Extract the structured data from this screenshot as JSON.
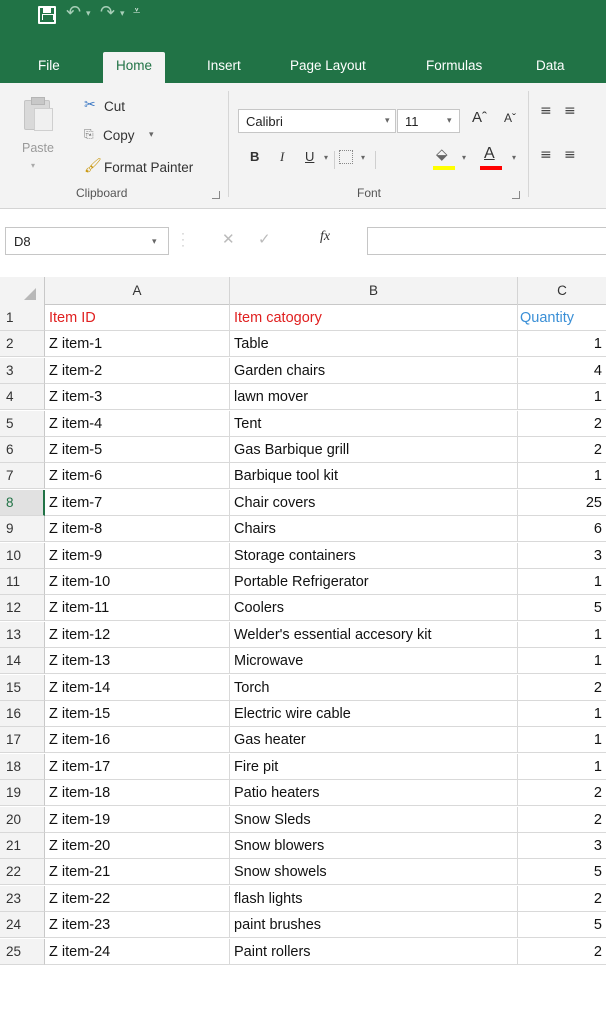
{
  "quick_access": {
    "save_icon": "save-icon",
    "undo_icon": "undo-icon",
    "redo_icon": "redo-icon",
    "customize_icon": "customize-icon",
    "undo_glyph": "↶",
    "redo_glyph": "↷",
    "dd_glyph": "▾",
    "custom_glyph": "⩡"
  },
  "tabs": [
    {
      "label": "File"
    },
    {
      "label": "Home"
    },
    {
      "label": "Insert"
    },
    {
      "label": "Page Layout"
    },
    {
      "label": "Formulas"
    },
    {
      "label": "Data"
    }
  ],
  "ribbon": {
    "clipboard": {
      "paste": "Paste",
      "cut": "Cut",
      "copy": "Copy",
      "copy_dd": "▾",
      "format_painter": "Format Painter",
      "label": "Clipboard",
      "cut_glyph": "✂",
      "copy_glyph": "⎘",
      "painter_glyph": "🖌"
    },
    "font": {
      "name": "Calibri",
      "size": "11",
      "grow_glyph": "Aˆ",
      "shrink_glyph": "Aˇ",
      "bold": "B",
      "italic": "I",
      "underline": "U",
      "fill_glyph": "⬙",
      "color_glyph": "A",
      "label": "Font",
      "fill_color": "#ffff00",
      "font_color": "#ff0000"
    },
    "alignment": {
      "top_glyph": "≡",
      "left_glyph": "≡"
    }
  },
  "formula_bar": {
    "name_box": "D8",
    "cancel_glyph": "✕",
    "enter_glyph": "✓",
    "fx": "fx",
    "formula": ""
  },
  "grid": {
    "columns": [
      "A",
      "B",
      "C"
    ],
    "selected_row": "8",
    "rows": [
      {
        "n": "1",
        "a": "Item ID",
        "b": "Item catogory",
        "c": "Quantity"
      },
      {
        "n": "2",
        "a": "Z item-1",
        "b": "Table",
        "c": "1"
      },
      {
        "n": "3",
        "a": "Z item-2",
        "b": "Garden chairs",
        "c": "4"
      },
      {
        "n": "4",
        "a": "Z item-3",
        "b": "lawn mover",
        "c": "1"
      },
      {
        "n": "5",
        "a": "Z item-4",
        "b": "Tent",
        "c": "2"
      },
      {
        "n": "6",
        "a": "Z item-5",
        "b": " Gas Barbique grill",
        "c": "2"
      },
      {
        "n": "7",
        "a": "Z item-6",
        "b": "Barbique tool kit",
        "c": "1"
      },
      {
        "n": "8",
        "a": "Z item-7",
        "b": "Chair covers",
        "c": "25"
      },
      {
        "n": "9",
        "a": "Z item-8",
        "b": "Chairs",
        "c": "6"
      },
      {
        "n": "10",
        "a": "Z item-9",
        "b": "Storage containers",
        "c": "3"
      },
      {
        "n": "11",
        "a": "Z item-10",
        "b": "Portable Refrigerator",
        "c": "1"
      },
      {
        "n": "12",
        "a": "Z item-11",
        "b": "Coolers",
        "c": "5"
      },
      {
        "n": "13",
        "a": "Z item-12",
        "b": "Welder's essential accesory kit",
        "c": "1"
      },
      {
        "n": "14",
        "a": "Z item-13",
        "b": "Microwave",
        "c": "1"
      },
      {
        "n": "15",
        "a": "Z item-14",
        "b": "Torch",
        "c": "2"
      },
      {
        "n": "16",
        "a": "Z item-15",
        "b": "Electric wire cable",
        "c": "1"
      },
      {
        "n": "17",
        "a": "Z item-16",
        "b": "Gas heater",
        "c": "1"
      },
      {
        "n": "18",
        "a": "Z item-17",
        "b": "Fire pit",
        "c": "1"
      },
      {
        "n": "19",
        "a": "Z item-18",
        "b": "Patio heaters",
        "c": "2"
      },
      {
        "n": "20",
        "a": "Z item-19",
        "b": "Snow Sleds",
        "c": "2"
      },
      {
        "n": "21",
        "a": "Z item-20",
        "b": "Snow blowers",
        "c": "3"
      },
      {
        "n": "22",
        "a": "Z item-21",
        "b": "Snow showels",
        "c": "5"
      },
      {
        "n": "23",
        "a": "Z item-22",
        "b": "flash lights",
        "c": "2"
      },
      {
        "n": "24",
        "a": "Z item-23",
        "b": "paint brushes",
        "c": "5"
      },
      {
        "n": "25",
        "a": "Z item-24",
        "b": "Paint rollers",
        "c": "2"
      }
    ]
  },
  "colors": {
    "brand": "#217346",
    "header_text_red": "#e02020",
    "header_text_blue": "#3a8fd6"
  }
}
